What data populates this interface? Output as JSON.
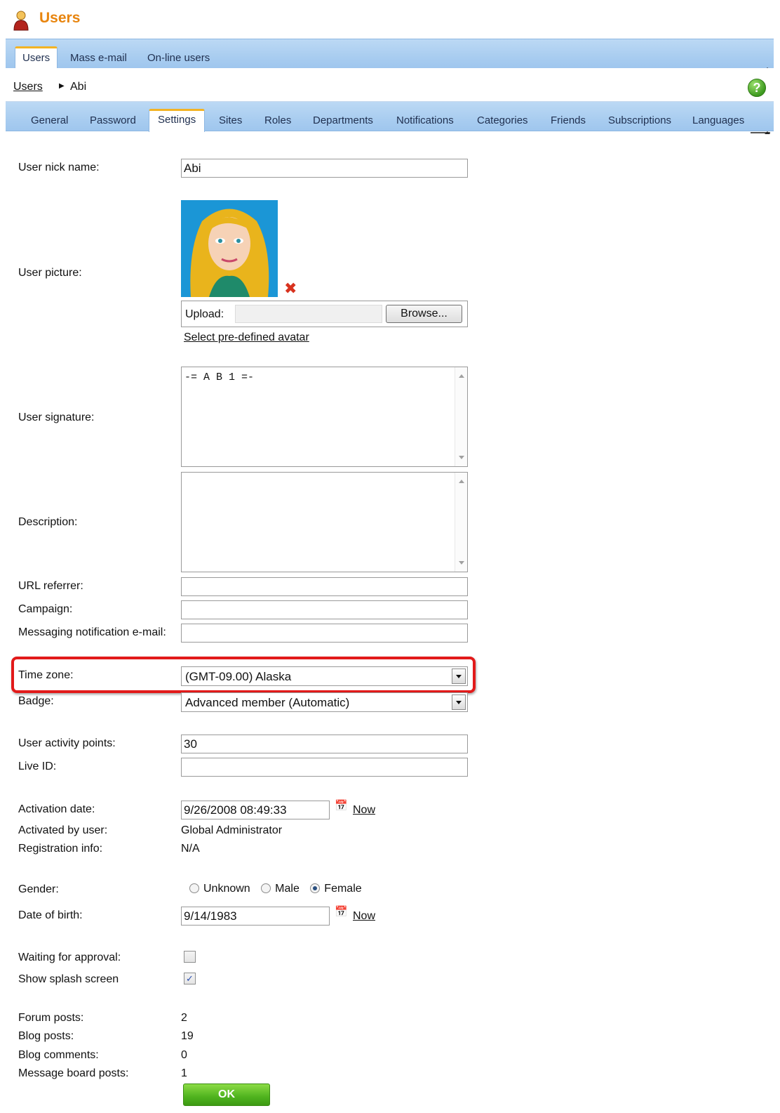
{
  "header": {
    "title": "Users",
    "icon": "user-icon"
  },
  "top_tabs": [
    {
      "label": "Users",
      "active": true
    },
    {
      "label": "Mass e-mail",
      "active": false
    },
    {
      "label": "On-line users",
      "active": false
    }
  ],
  "breadcrumb": {
    "parent": "Users",
    "current": "Abi"
  },
  "sub_tabs": [
    {
      "label": "General"
    },
    {
      "label": "Password"
    },
    {
      "label": "Settings",
      "active": true
    },
    {
      "label": "Sites"
    },
    {
      "label": "Roles"
    },
    {
      "label": "Departments"
    },
    {
      "label": "Notifications"
    },
    {
      "label": "Categories"
    },
    {
      "label": "Friends"
    },
    {
      "label": "Subscriptions"
    },
    {
      "label": "Languages"
    }
  ],
  "form": {
    "nick_name": {
      "label": "User nick name:",
      "value": "Abi"
    },
    "picture": {
      "label": "User picture:",
      "upload_label": "Upload:",
      "browse": "Browse...",
      "select_avatar": "Select pre-defined avatar"
    },
    "signature": {
      "label": "User signature:",
      "value": "-= A B 1 =-"
    },
    "description": {
      "label": "Description:",
      "value": ""
    },
    "url_referrer": {
      "label": "URL referrer:",
      "value": ""
    },
    "campaign": {
      "label": "Campaign:",
      "value": ""
    },
    "messaging_email": {
      "label": "Messaging notification e-mail:",
      "value": ""
    },
    "time_zone": {
      "label": "Time zone:",
      "value": "(GMT-09.00) Alaska"
    },
    "badge": {
      "label": "Badge:",
      "value": "Advanced member (Automatic)"
    },
    "activity_points": {
      "label": "User activity points:",
      "value": "30"
    },
    "live_id": {
      "label": "Live ID:",
      "value": ""
    },
    "activation_date": {
      "label": "Activation date:",
      "value": "9/26/2008 08:49:33",
      "now": "Now"
    },
    "activated_by": {
      "label": "Activated by user:",
      "value": "Global Administrator"
    },
    "registration_info": {
      "label": "Registration info:",
      "value": "N/A"
    },
    "gender": {
      "label": "Gender:",
      "options": [
        "Unknown",
        "Male",
        "Female"
      ],
      "selected": "Female"
    },
    "date_of_birth": {
      "label": "Date of birth:",
      "value": "9/14/1983",
      "now": "Now"
    },
    "waiting_for_approval": {
      "label": "Waiting for approval:",
      "checked": false
    },
    "show_splash": {
      "label": "Show splash screen",
      "checked": true
    },
    "forum_posts": {
      "label": "Forum posts:",
      "value": "2"
    },
    "blog_posts": {
      "label": "Blog posts:",
      "value": "19"
    },
    "blog_comments": {
      "label": "Blog comments:",
      "value": "0"
    },
    "message_board_posts": {
      "label": "Message board posts:",
      "value": "1"
    },
    "ok": "OK"
  },
  "colors": {
    "accent": "#e8850f",
    "tab_bar": "#a9cdf0",
    "highlight": "#e21a1a",
    "ok_button": "#4fb31e"
  }
}
